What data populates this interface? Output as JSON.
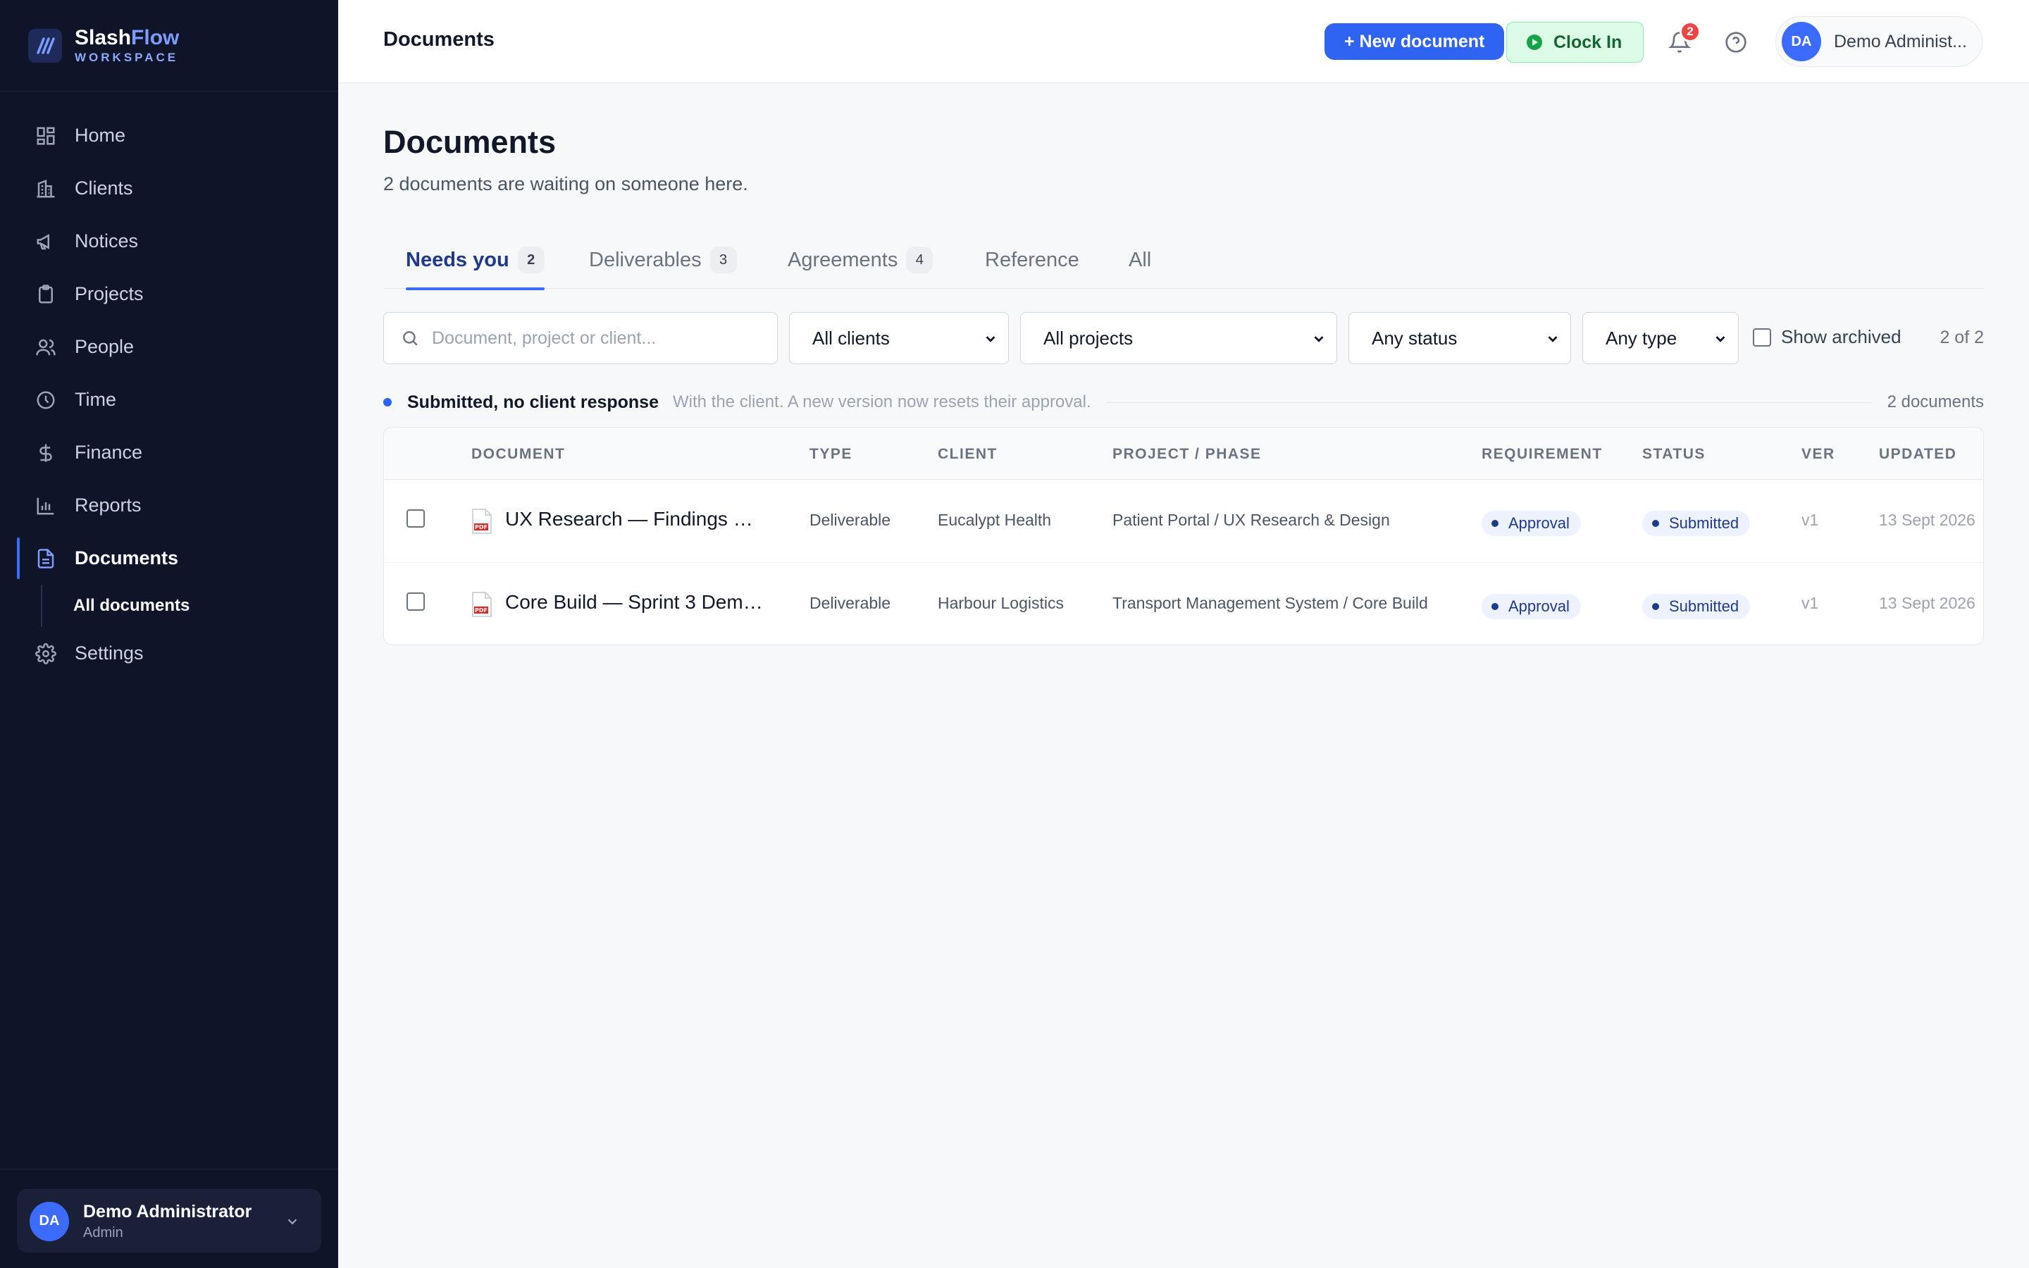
{
  "brand": {
    "name_part1": "Slash",
    "name_part2": "Flow",
    "sub": "WORKSPACE"
  },
  "sidebar": {
    "items": [
      {
        "label": "Home",
        "icon": "grid-icon"
      },
      {
        "label": "Clients",
        "icon": "building-icon"
      },
      {
        "label": "Notices",
        "icon": "megaphone-icon"
      },
      {
        "label": "Projects",
        "icon": "clipboard-icon"
      },
      {
        "label": "People",
        "icon": "users-icon"
      },
      {
        "label": "Time",
        "icon": "clock-icon"
      },
      {
        "label": "Finance",
        "icon": "dollar-icon"
      },
      {
        "label": "Reports",
        "icon": "bar-chart-icon"
      },
      {
        "label": "Documents",
        "icon": "document-icon",
        "active": true
      },
      {
        "label": "Settings",
        "icon": "gear-icon"
      }
    ],
    "sub_item": "All documents",
    "user": {
      "initials": "DA",
      "name": "Demo Administrator",
      "role": "Admin"
    }
  },
  "topbar": {
    "title": "Documents",
    "new_document": "+ New document",
    "clock_in": "Clock In",
    "notifications": "2",
    "profile_initials": "DA",
    "profile_name": "Demo Administ..."
  },
  "page": {
    "heading": "Documents",
    "subtitle": "2 documents are waiting on someone here."
  },
  "tabs": [
    {
      "label": "Needs you",
      "count": "2",
      "active": true
    },
    {
      "label": "Deliverables",
      "count": "3"
    },
    {
      "label": "Agreements",
      "count": "4"
    },
    {
      "label": "Reference"
    },
    {
      "label": "All"
    }
  ],
  "filters": {
    "search_placeholder": "Document, project or client...",
    "clients": "All clients",
    "projects": "All projects",
    "status": "Any status",
    "type": "Any type",
    "show_archived": "Show archived",
    "count": "2 of 2"
  },
  "group": {
    "title": "Submitted, no client response",
    "description": "With the client. A new version now resets their approval.",
    "count": "2 documents"
  },
  "table": {
    "headers": {
      "document": "DOCUMENT",
      "type": "TYPE",
      "client": "CLIENT",
      "project": "PROJECT / PHASE",
      "requirement": "REQUIREMENT",
      "status": "STATUS",
      "ver": "VER",
      "updated": "UPDATED"
    },
    "rows": [
      {
        "document": "UX Research — Findings & ...",
        "type": "Deliverable",
        "client": "Eucalypt Health",
        "project": "Patient Portal / UX Research & Design",
        "requirement": "Approval",
        "status": "Submitted",
        "ver": "v1",
        "updated": "13 Sept 2026"
      },
      {
        "document": "Core Build — Sprint 3 Demo...",
        "type": "Deliverable",
        "client": "Harbour Logistics",
        "project": "Transport Management System / Core Build",
        "requirement": "Approval",
        "status": "Submitted",
        "ver": "v1",
        "updated": "13 Sept 2026"
      }
    ]
  },
  "colors": {
    "sidebar_bg": "#0f1429",
    "accent": "#2f63f2",
    "clock_green": "#dcfce7",
    "badge_red": "#ef4444"
  }
}
